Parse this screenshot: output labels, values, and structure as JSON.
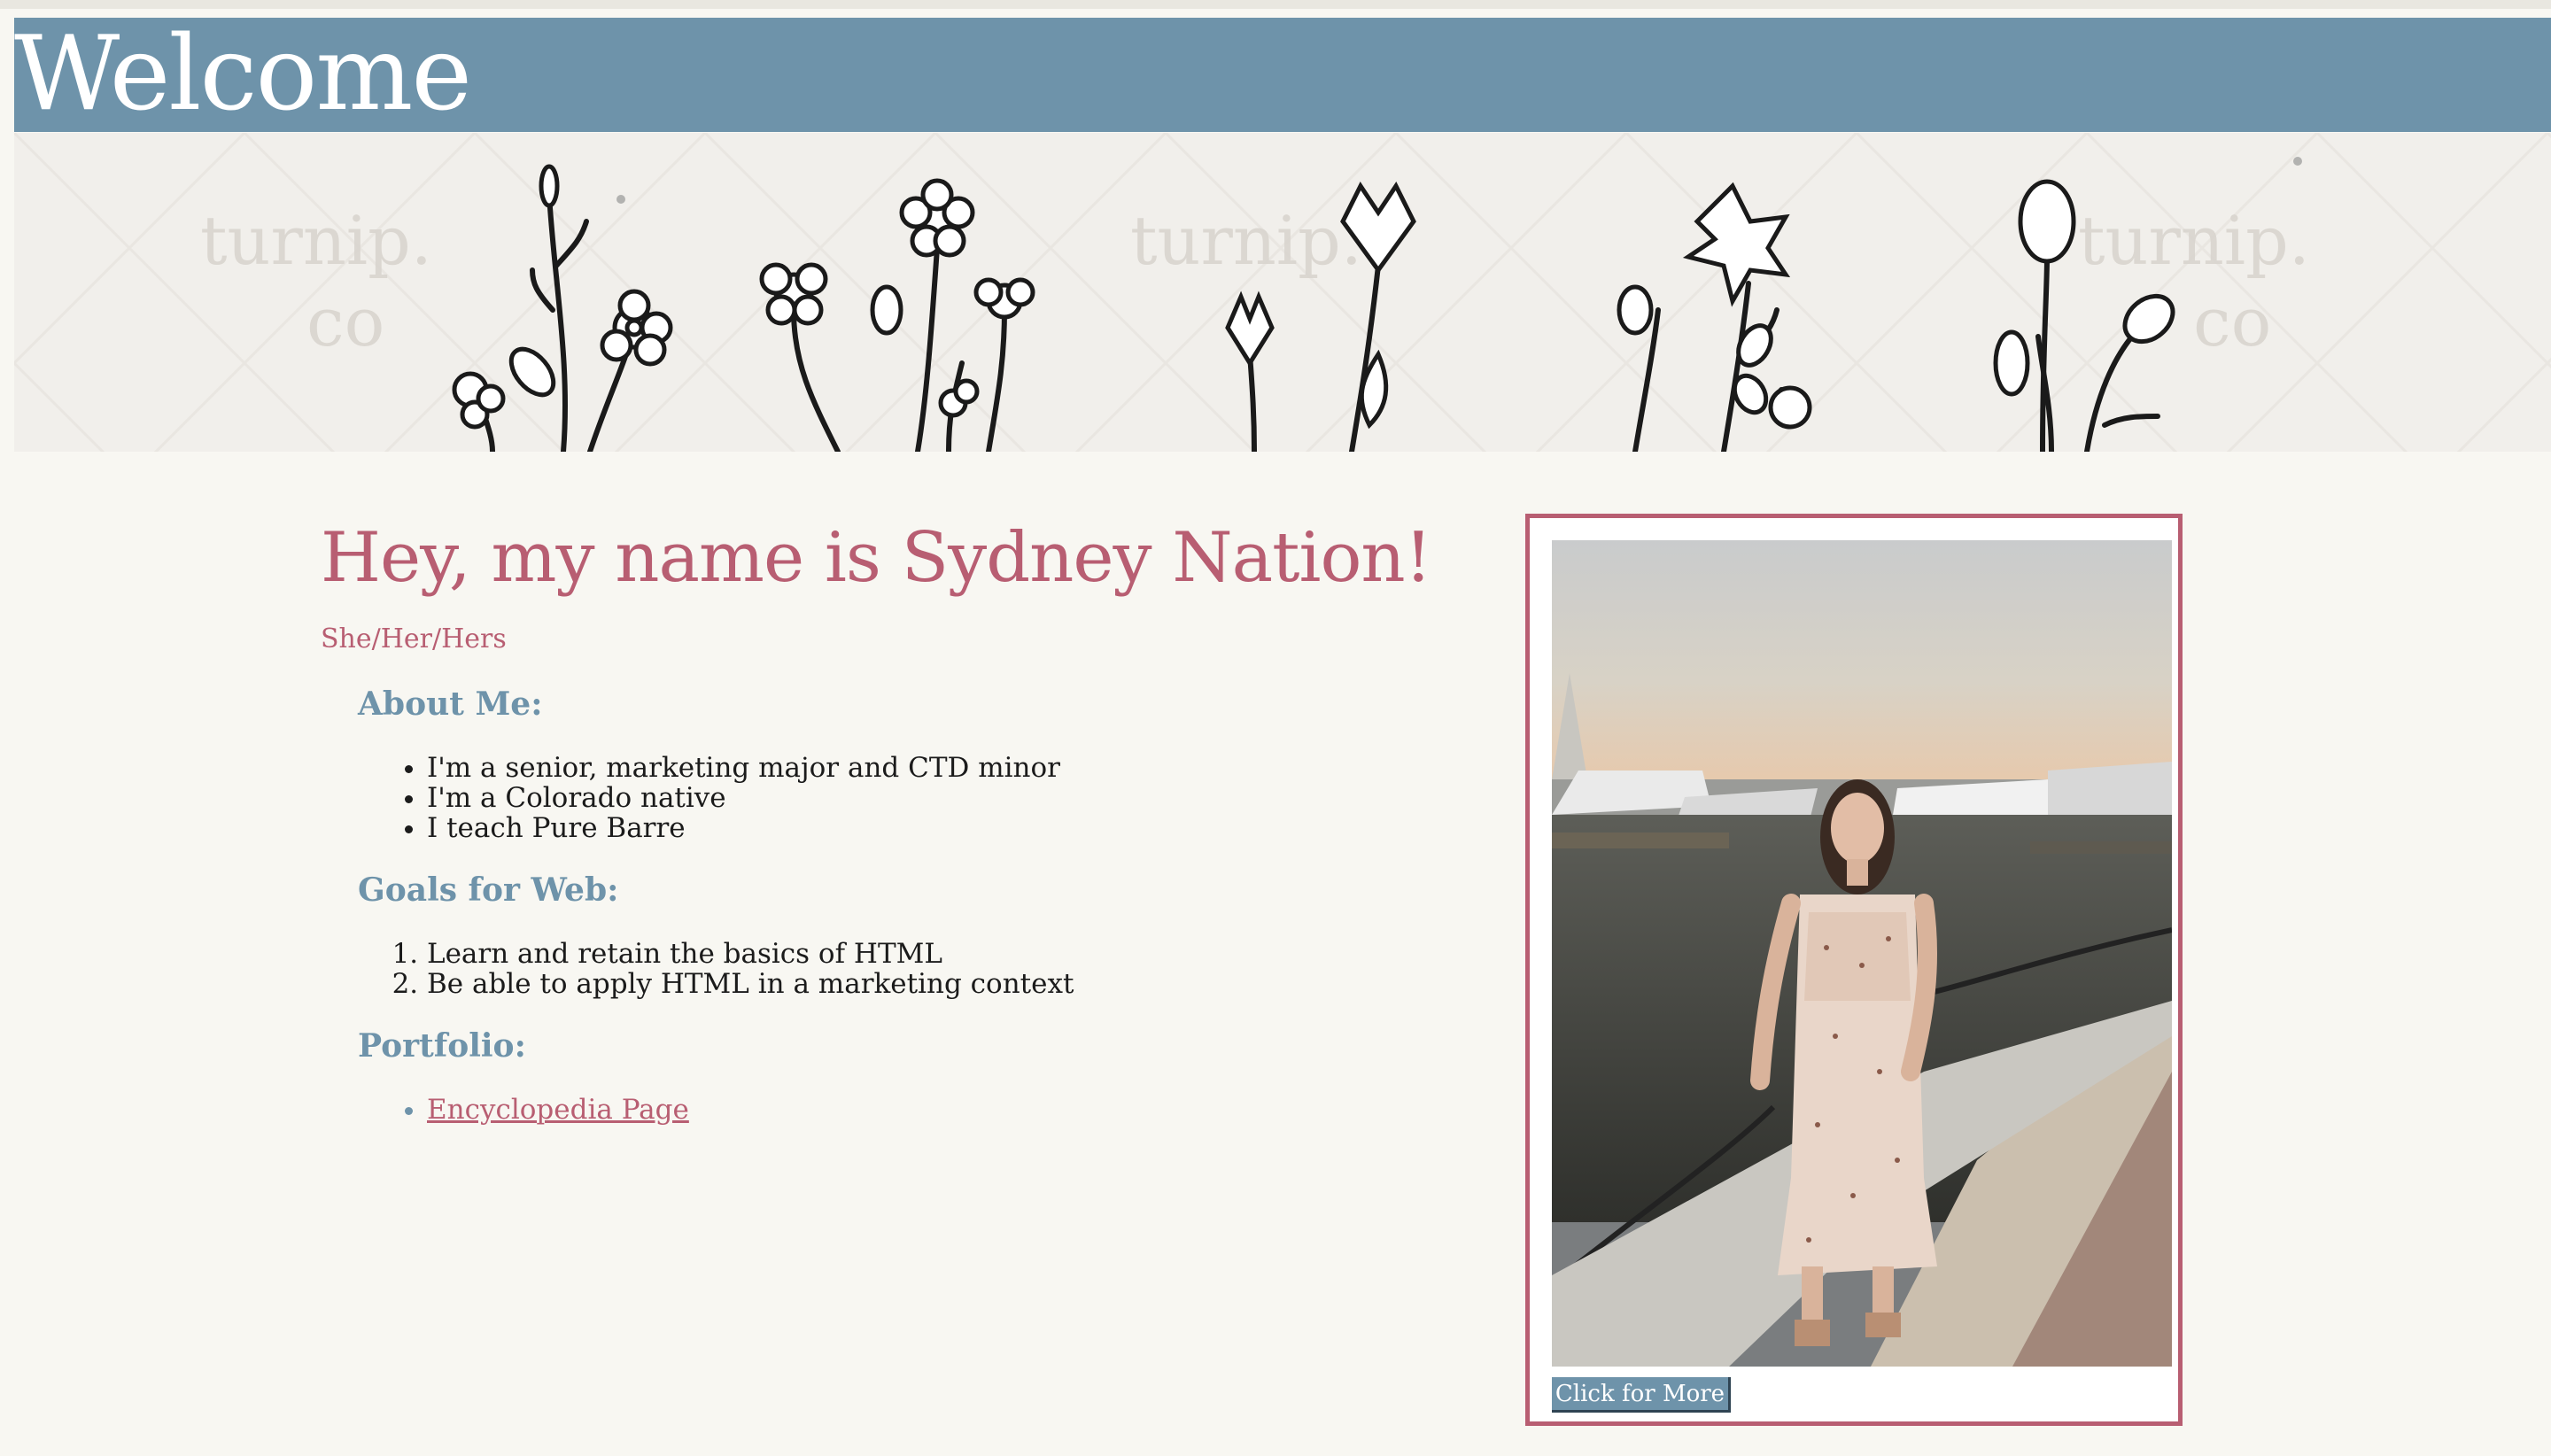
{
  "header": {
    "title": "Welcome"
  },
  "banner": {
    "watermark": "turnip.\nco"
  },
  "intro": {
    "name": "Hey, my name is Sydney Nation!",
    "pronouns": "She/Her/Hers"
  },
  "about": {
    "title": "About Me:",
    "items": [
      "I'm a senior, marketing major and CTD minor",
      "I'm a Colorado native",
      "I teach Pure Barre"
    ]
  },
  "goals": {
    "title": "Goals for Web:",
    "items": [
      "Learn and retain the basics of HTML",
      "Be able to apply HTML in a marketing context"
    ]
  },
  "portfolio": {
    "title": "Portfolio:",
    "links": [
      "Encyclopedia Page"
    ]
  },
  "photo_card": {
    "button_label": "Click for More"
  },
  "colors": {
    "header_bg": "#6e93aa",
    "accent": "#b85e72",
    "page_bg": "#f8f7f2",
    "text": "#1b1b1b"
  }
}
